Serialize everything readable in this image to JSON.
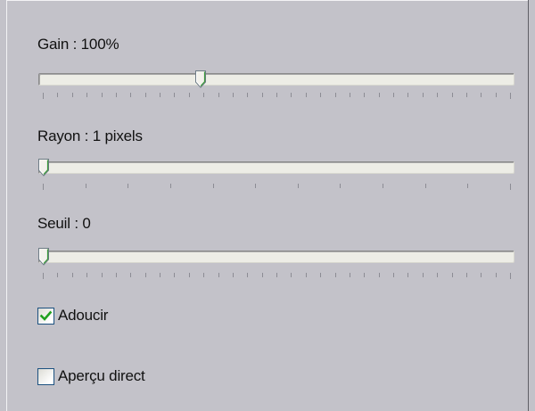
{
  "sliders": [
    {
      "label": "Gain : 100%",
      "value_fraction": 0.337,
      "tick_count": 33
    },
    {
      "label": "Rayon : 1 pixels",
      "value_fraction": 0.0,
      "tick_count": 12
    },
    {
      "label": "Seuil : 0",
      "value_fraction": 0.0,
      "tick_count": 33
    }
  ],
  "checkboxes": [
    {
      "label": "Adoucir",
      "checked": true
    },
    {
      "label": "Aperçu direct",
      "checked": false
    }
  ],
  "colors": {
    "panel_bg": "#c3c2c9",
    "track_bg": "#edede6",
    "check_mark": "#21a121",
    "thumb_accent": "#3a9a3a"
  }
}
